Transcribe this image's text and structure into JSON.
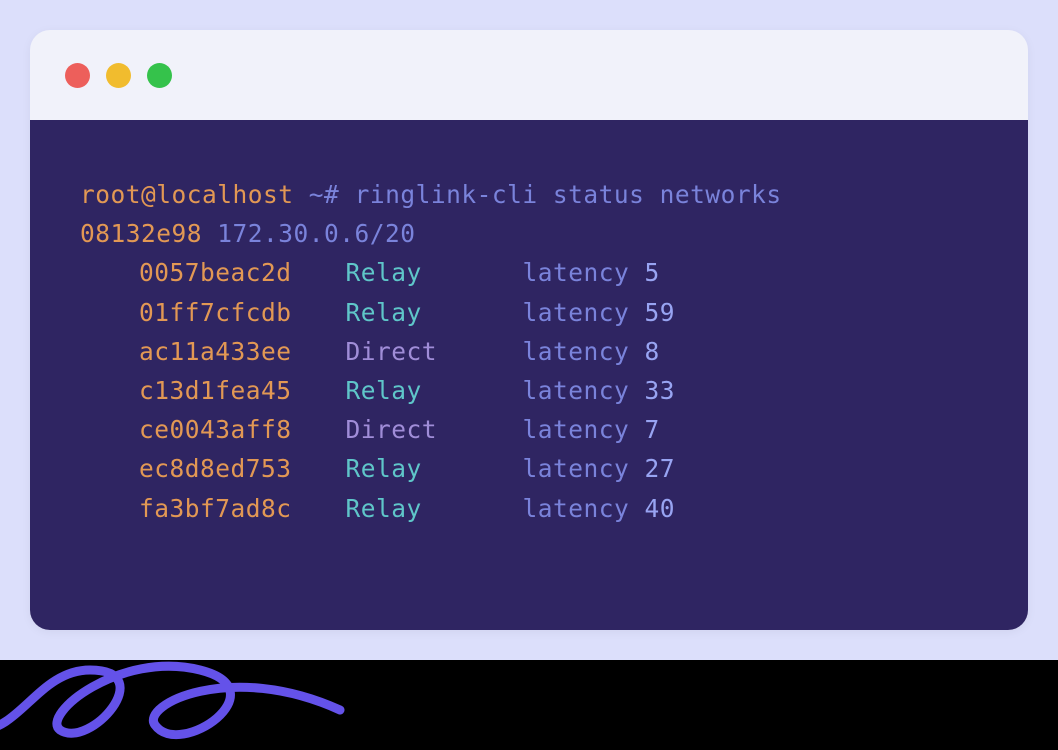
{
  "colors": {
    "page_bg": "#dcdffb",
    "terminal_bg": "#2f2562",
    "titlebar_bg": "#f1f2fa",
    "orange": "#e29854",
    "blue": "#7a83db",
    "cyan": "#5fc6c9",
    "purple": "#a08dd8",
    "lightblue": "#98a4f2",
    "squiggle": "#6452e9"
  },
  "traffic_lights": [
    "red",
    "yellow",
    "green"
  ],
  "prompt": {
    "user_host": "root@localhost",
    "path_symbol": "~#",
    "command": "ringlink-cli status networks"
  },
  "network": {
    "id": "08132e98",
    "cidr": "172.30.0.6/20"
  },
  "latency_label": "latency",
  "peers": [
    {
      "id": "0057beac2d",
      "type": "Relay",
      "latency": 5
    },
    {
      "id": "01ff7cfcdb",
      "type": "Relay",
      "latency": 59
    },
    {
      "id": "ac11a433ee",
      "type": "Direct",
      "latency": 8
    },
    {
      "id": "c13d1fea45",
      "type": "Relay",
      "latency": 33
    },
    {
      "id": "ce0043aff8",
      "type": "Direct",
      "latency": 7
    },
    {
      "id": "ec8d8ed753",
      "type": "Relay",
      "latency": 27
    },
    {
      "id": "fa3bf7ad8c",
      "type": "Relay",
      "latency": 40
    }
  ]
}
